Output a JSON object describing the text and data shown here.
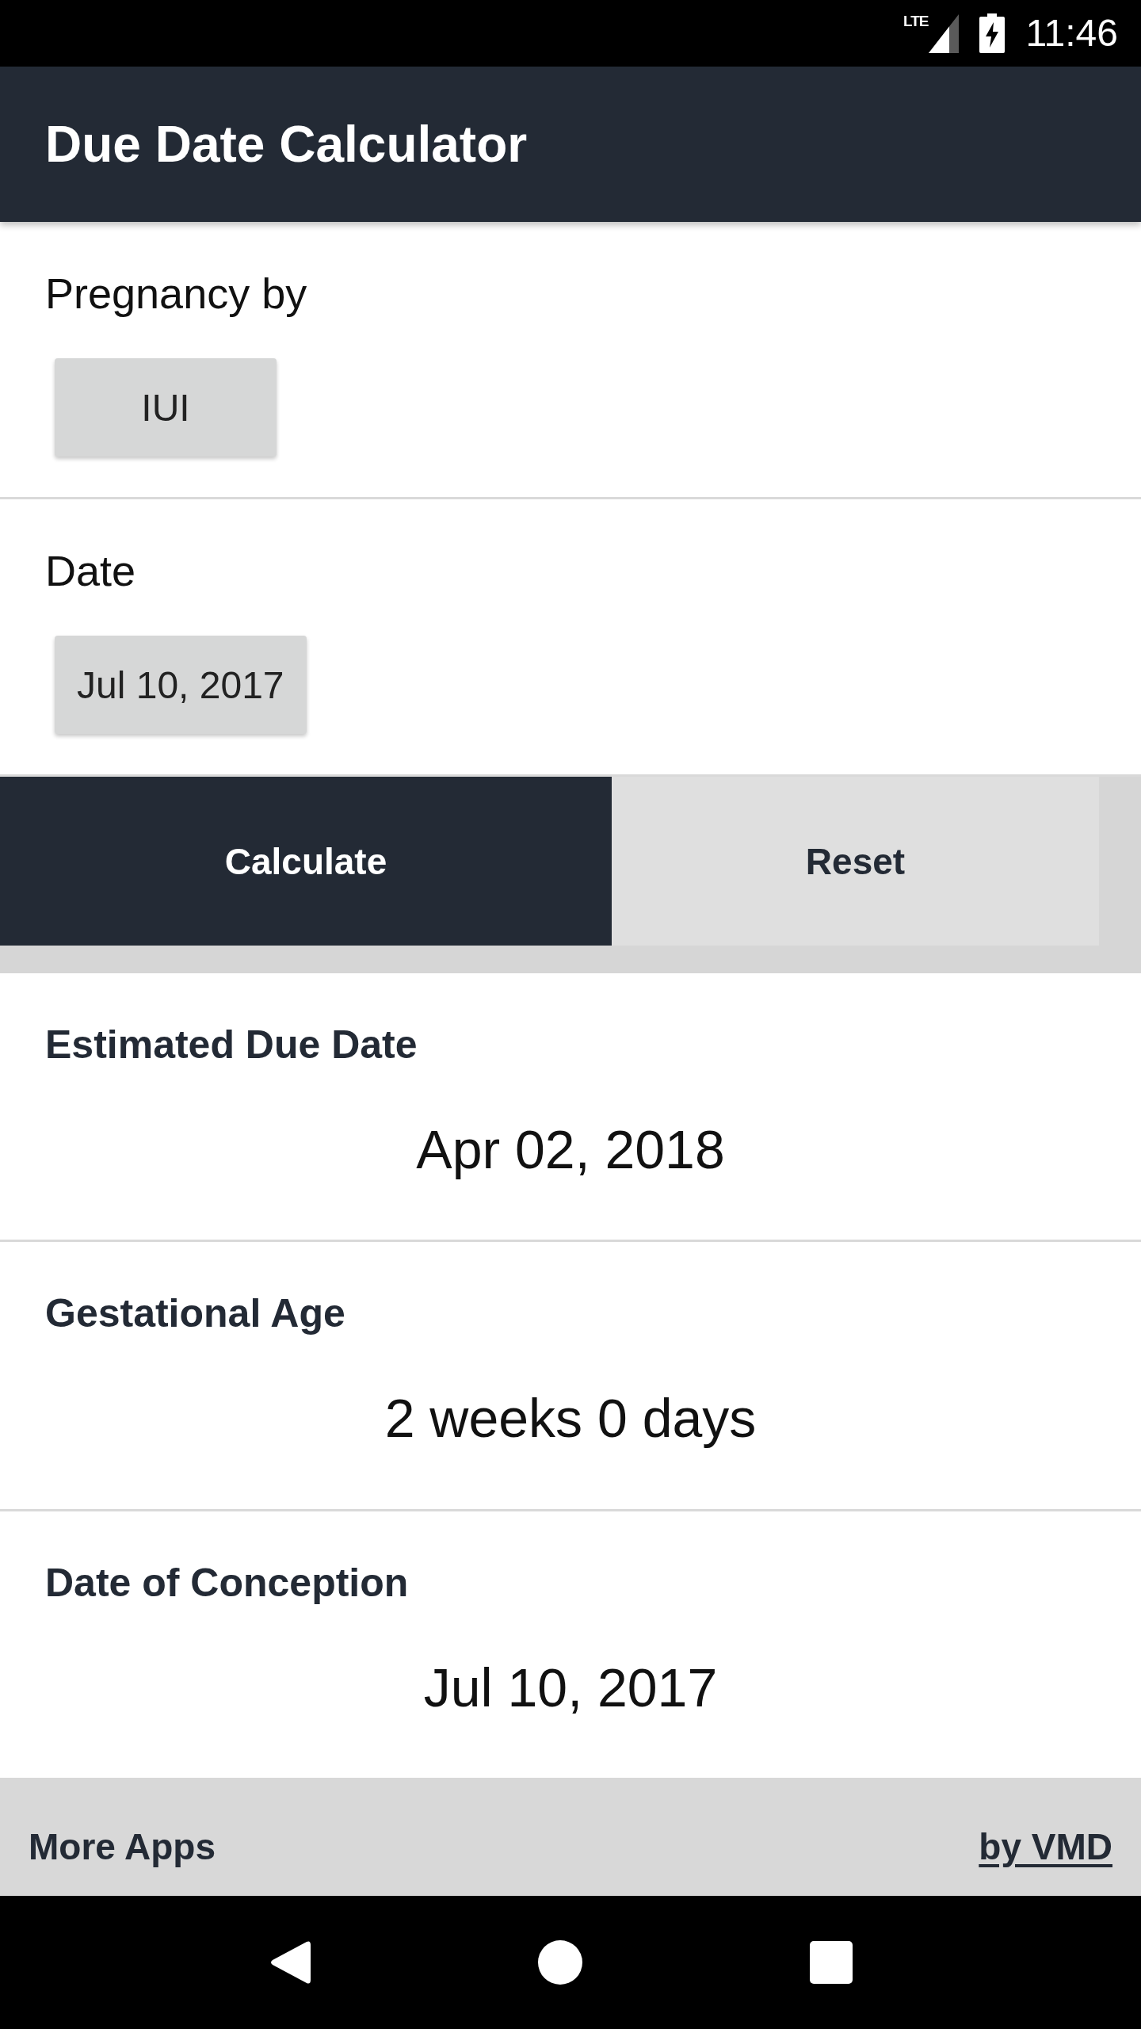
{
  "status_bar": {
    "network": "LTE",
    "time": "11:46"
  },
  "app_bar": {
    "title": "Due Date Calculator"
  },
  "fields": [
    {
      "label": "Pregnancy by",
      "value": "IUI"
    },
    {
      "label": "Date",
      "value": "Jul 10, 2017"
    }
  ],
  "actions": [
    {
      "label": "Calculate",
      "kind": "primary"
    },
    {
      "label": "Reset",
      "kind": "secondary"
    }
  ],
  "results": [
    {
      "label": "Estimated Due Date",
      "value": "Apr 02, 2018"
    },
    {
      "label": "Gestational Age",
      "value": "2 weeks 0 days"
    },
    {
      "label": "Date of Conception",
      "value": "Jul 10, 2017"
    }
  ],
  "footer": {
    "more_apps": "More Apps",
    "credit": "by VMD"
  }
}
